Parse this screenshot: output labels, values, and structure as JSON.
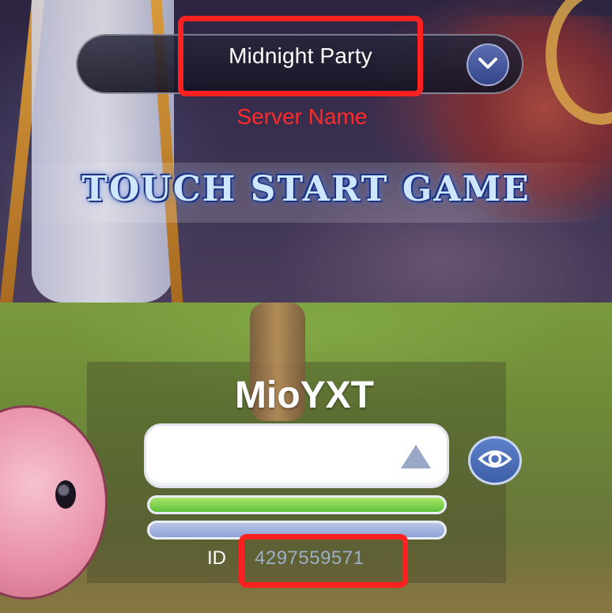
{
  "server_select": {
    "server_name": "Midnight Party",
    "annotation_label": "Server Name",
    "dropdown_icon": "chevron-down-icon",
    "start_prompt": "TOUCH START GAME"
  },
  "character": {
    "name": "MioYXT",
    "input_value": "",
    "toggle_icon": "eye-icon",
    "hp_fraction": 1.0,
    "mp_fraction": 1.0,
    "id_label": "ID",
    "id_value": "4297559571"
  },
  "colors": {
    "highlight": "#ff2020",
    "annotation_text": "#ff2a2a",
    "hp_bar": "#5fc23a",
    "mp_bar": "#8ea2d6",
    "button_blue": "#3d5fa8"
  }
}
